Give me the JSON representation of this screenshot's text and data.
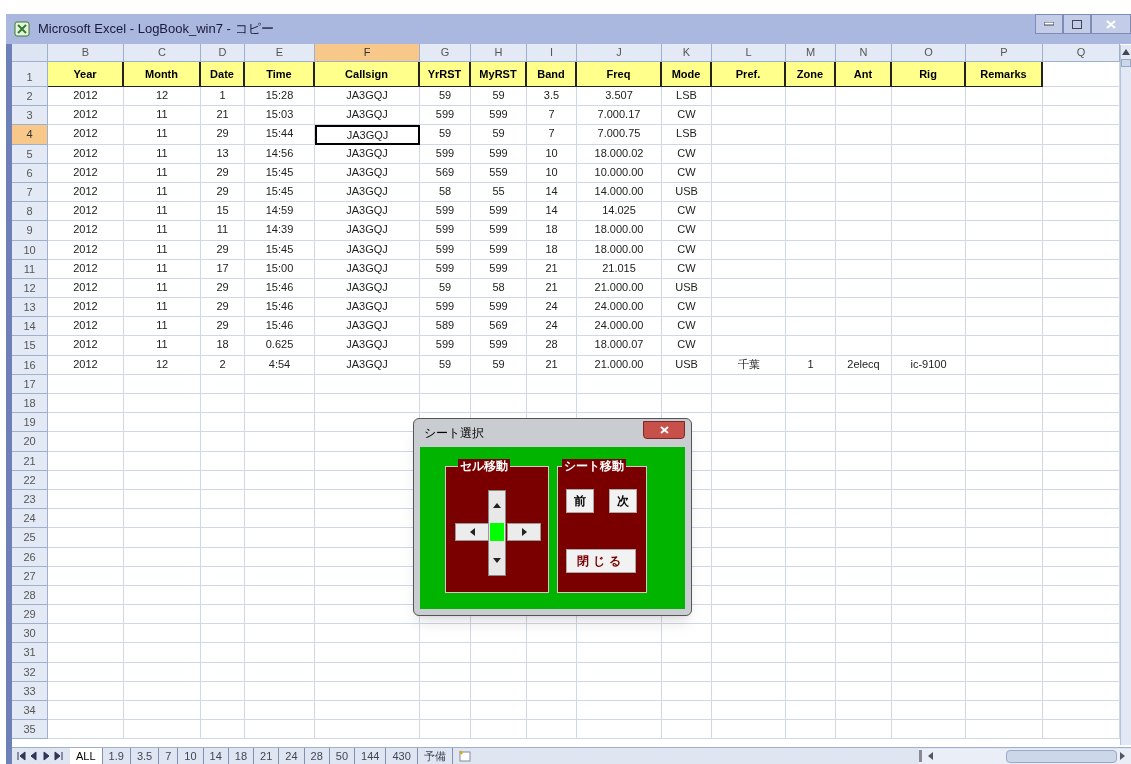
{
  "window": {
    "title": "Microsoft Excel - LogBook_win7 - コピー"
  },
  "columns": [
    {
      "letter": "B",
      "selected": false
    },
    {
      "letter": "C",
      "selected": false
    },
    {
      "letter": "D",
      "selected": false
    },
    {
      "letter": "E",
      "selected": false
    },
    {
      "letter": "F",
      "selected": true
    },
    {
      "letter": "G",
      "selected": false
    },
    {
      "letter": "H",
      "selected": false
    },
    {
      "letter": "I",
      "selected": false
    },
    {
      "letter": "J",
      "selected": false
    },
    {
      "letter": "K",
      "selected": false
    },
    {
      "letter": "L",
      "selected": false
    },
    {
      "letter": "M",
      "selected": false
    },
    {
      "letter": "N",
      "selected": false
    },
    {
      "letter": "O",
      "selected": false
    },
    {
      "letter": "P",
      "selected": false
    },
    {
      "letter": "Q",
      "selected": false
    }
  ],
  "header_row": {
    "number": "1",
    "cells": [
      "Year",
      "Month",
      "Date",
      "Time",
      "Callsign",
      "YrRST",
      "MyRST",
      "Band",
      "Freq",
      "Mode",
      "Pref.",
      "Zone",
      "Ant",
      "Rig",
      "Remarks"
    ]
  },
  "rows": [
    {
      "number": "2",
      "selected": false,
      "cells": [
        "2012",
        "12",
        "1",
        "15:28",
        "JA3GQJ",
        "59",
        "59",
        "3.5",
        "3.507",
        "LSB"
      ]
    },
    {
      "number": "3",
      "selected": false,
      "cells": [
        "2012",
        "11",
        "21",
        "15:03",
        "JA3GQJ",
        "599",
        "599",
        "7",
        "7.000.17",
        "CW"
      ]
    },
    {
      "number": "4",
      "selected": true,
      "cells": [
        "2012",
        "11",
        "29",
        "15:44",
        "JA3GQJ",
        "59",
        "59",
        "7",
        "7.000.75",
        "LSB"
      ]
    },
    {
      "number": "5",
      "selected": false,
      "cells": [
        "2012",
        "11",
        "13",
        "14:56",
        "JA3GQJ",
        "599",
        "599",
        "10",
        "18.000.02",
        "CW"
      ]
    },
    {
      "number": "6",
      "selected": false,
      "cells": [
        "2012",
        "11",
        "29",
        "15:45",
        "JA3GQJ",
        "569",
        "559",
        "10",
        "10.000.00",
        "CW"
      ]
    },
    {
      "number": "7",
      "selected": false,
      "cells": [
        "2012",
        "11",
        "29",
        "15:45",
        "JA3GQJ",
        "58",
        "55",
        "14",
        "14.000.00",
        "USB"
      ]
    },
    {
      "number": "8",
      "selected": false,
      "cells": [
        "2012",
        "11",
        "15",
        "14:59",
        "JA3GQJ",
        "599",
        "599",
        "14",
        "14.025",
        "CW"
      ]
    },
    {
      "number": "9",
      "selected": false,
      "cells": [
        "2012",
        "11",
        "11",
        "14:39",
        "JA3GQJ",
        "599",
        "599",
        "18",
        "18.000.00",
        "CW"
      ]
    },
    {
      "number": "10",
      "selected": false,
      "cells": [
        "2012",
        "11",
        "29",
        "15:45",
        "JA3GQJ",
        "599",
        "599",
        "18",
        "18.000.00",
        "CW"
      ]
    },
    {
      "number": "11",
      "selected": false,
      "cells": [
        "2012",
        "11",
        "17",
        "15:00",
        "JA3GQJ",
        "599",
        "599",
        "21",
        "21.015",
        "CW"
      ]
    },
    {
      "number": "12",
      "selected": false,
      "cells": [
        "2012",
        "11",
        "29",
        "15:46",
        "JA3GQJ",
        "59",
        "58",
        "21",
        "21.000.00",
        "USB"
      ]
    },
    {
      "number": "13",
      "selected": false,
      "cells": [
        "2012",
        "11",
        "29",
        "15:46",
        "JA3GQJ",
        "599",
        "599",
        "24",
        "24.000.00",
        "CW"
      ]
    },
    {
      "number": "14",
      "selected": false,
      "cells": [
        "2012",
        "11",
        "29",
        "15:46",
        "JA3GQJ",
        "589",
        "569",
        "24",
        "24.000.00",
        "CW"
      ]
    },
    {
      "number": "15",
      "selected": false,
      "cells": [
        "2012",
        "11",
        "18",
        "0.625",
        "JA3GQJ",
        "599",
        "599",
        "28",
        "18.000.07",
        "CW"
      ]
    },
    {
      "number": "16",
      "selected": false,
      "cells": [
        "2012",
        "12",
        "2",
        "4:54",
        "JA3GQJ",
        "59",
        "59",
        "21",
        "21.000.00",
        "USB",
        "千葉",
        "1",
        "2elecq",
        "ic-9100"
      ]
    }
  ],
  "empty_rows": [
    "17",
    "18",
    "19",
    "20",
    "21",
    "22",
    "23",
    "24",
    "25",
    "26",
    "27",
    "28",
    "29",
    "30",
    "31",
    "32",
    "33",
    "34",
    "35"
  ],
  "sheet_tabs": [
    {
      "label": "ALL",
      "selected": true
    },
    {
      "label": "1.9",
      "selected": false
    },
    {
      "label": "3.5",
      "selected": false
    },
    {
      "label": "7",
      "selected": false
    },
    {
      "label": "10",
      "selected": false
    },
    {
      "label": "14",
      "selected": false
    },
    {
      "label": "18",
      "selected": false
    },
    {
      "label": "21",
      "selected": false
    },
    {
      "label": "24",
      "selected": false
    },
    {
      "label": "28",
      "selected": false
    },
    {
      "label": "50",
      "selected": false
    },
    {
      "label": "144",
      "selected": false
    },
    {
      "label": "430",
      "selected": false
    },
    {
      "label": "予備",
      "selected": false
    }
  ],
  "dialog": {
    "title": "シート選択",
    "cell_frame": "セル移動",
    "sheet_frame": "シート移動",
    "prev_button": "前",
    "next_button": "次",
    "close_button": "閉じる"
  }
}
